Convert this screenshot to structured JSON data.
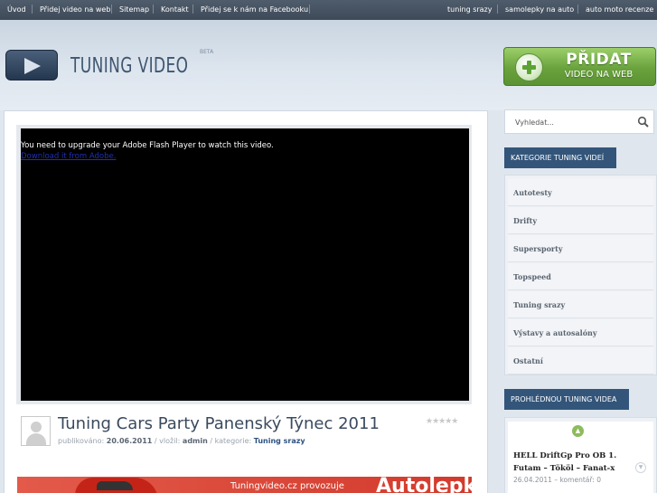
{
  "topnav": {
    "left": [
      "Úvod",
      "Přidej video na web",
      "Sitemap",
      "Kontakt",
      "Přidej se k nám na Facebooku"
    ],
    "right": [
      "tuning srazy",
      "samolepky na auto",
      "auto moto recenze"
    ]
  },
  "header": {
    "logo_text": "TUNING VIDEO",
    "logo_badge": "BETA",
    "add_button_line1": "PŘIDAT",
    "add_button_line2": "VIDEO NA WEB"
  },
  "video": {
    "upgrade_message": "You need to upgrade your Adobe Flash Player to watch this video.",
    "download_link": "Download it from Adobe."
  },
  "post": {
    "title": "Tuning Cars Party Panenský Týnec 2011",
    "published_label": "publikováno:",
    "published_date": "20.06.2011",
    "author_label": "vložil:",
    "author": "admin",
    "category_label": "kategorie:",
    "category": "Tuning srazy",
    "rating_stars": "★★★★★"
  },
  "banner": {
    "text": "Tuningvideo.cz provozuje",
    "brand": "Autolepky.cz"
  },
  "sidebar": {
    "search_placeholder": "Vyhledat...",
    "categories_heading": "KATEGORIE TUNING VIDEÍ",
    "categories": [
      "Autotesty",
      "Drifty",
      "Supersporty",
      "Topspeed",
      "Tuning srazy",
      "Výstavy a autosalóny",
      "Ostatní"
    ],
    "popular_heading": "PROHLÉDNOU TUNING VIDEA",
    "popular_item_title": "HELL DriftGp Pro OB 1. Futam – Tököl – Fanat-x",
    "popular_item_date": "26.04.2011",
    "popular_item_comments": "komentář: 0"
  },
  "colors": {
    "nav_bg": "#46525f",
    "heading_bg": "#33557a",
    "add_button_green": "#6aa23d",
    "category_link": "#2c5282"
  },
  "icons": [
    "play-icon",
    "plus-icon",
    "search-icon",
    "user-avatar-icon",
    "star-icon",
    "arrow-up-icon",
    "arrow-down-icon"
  ]
}
